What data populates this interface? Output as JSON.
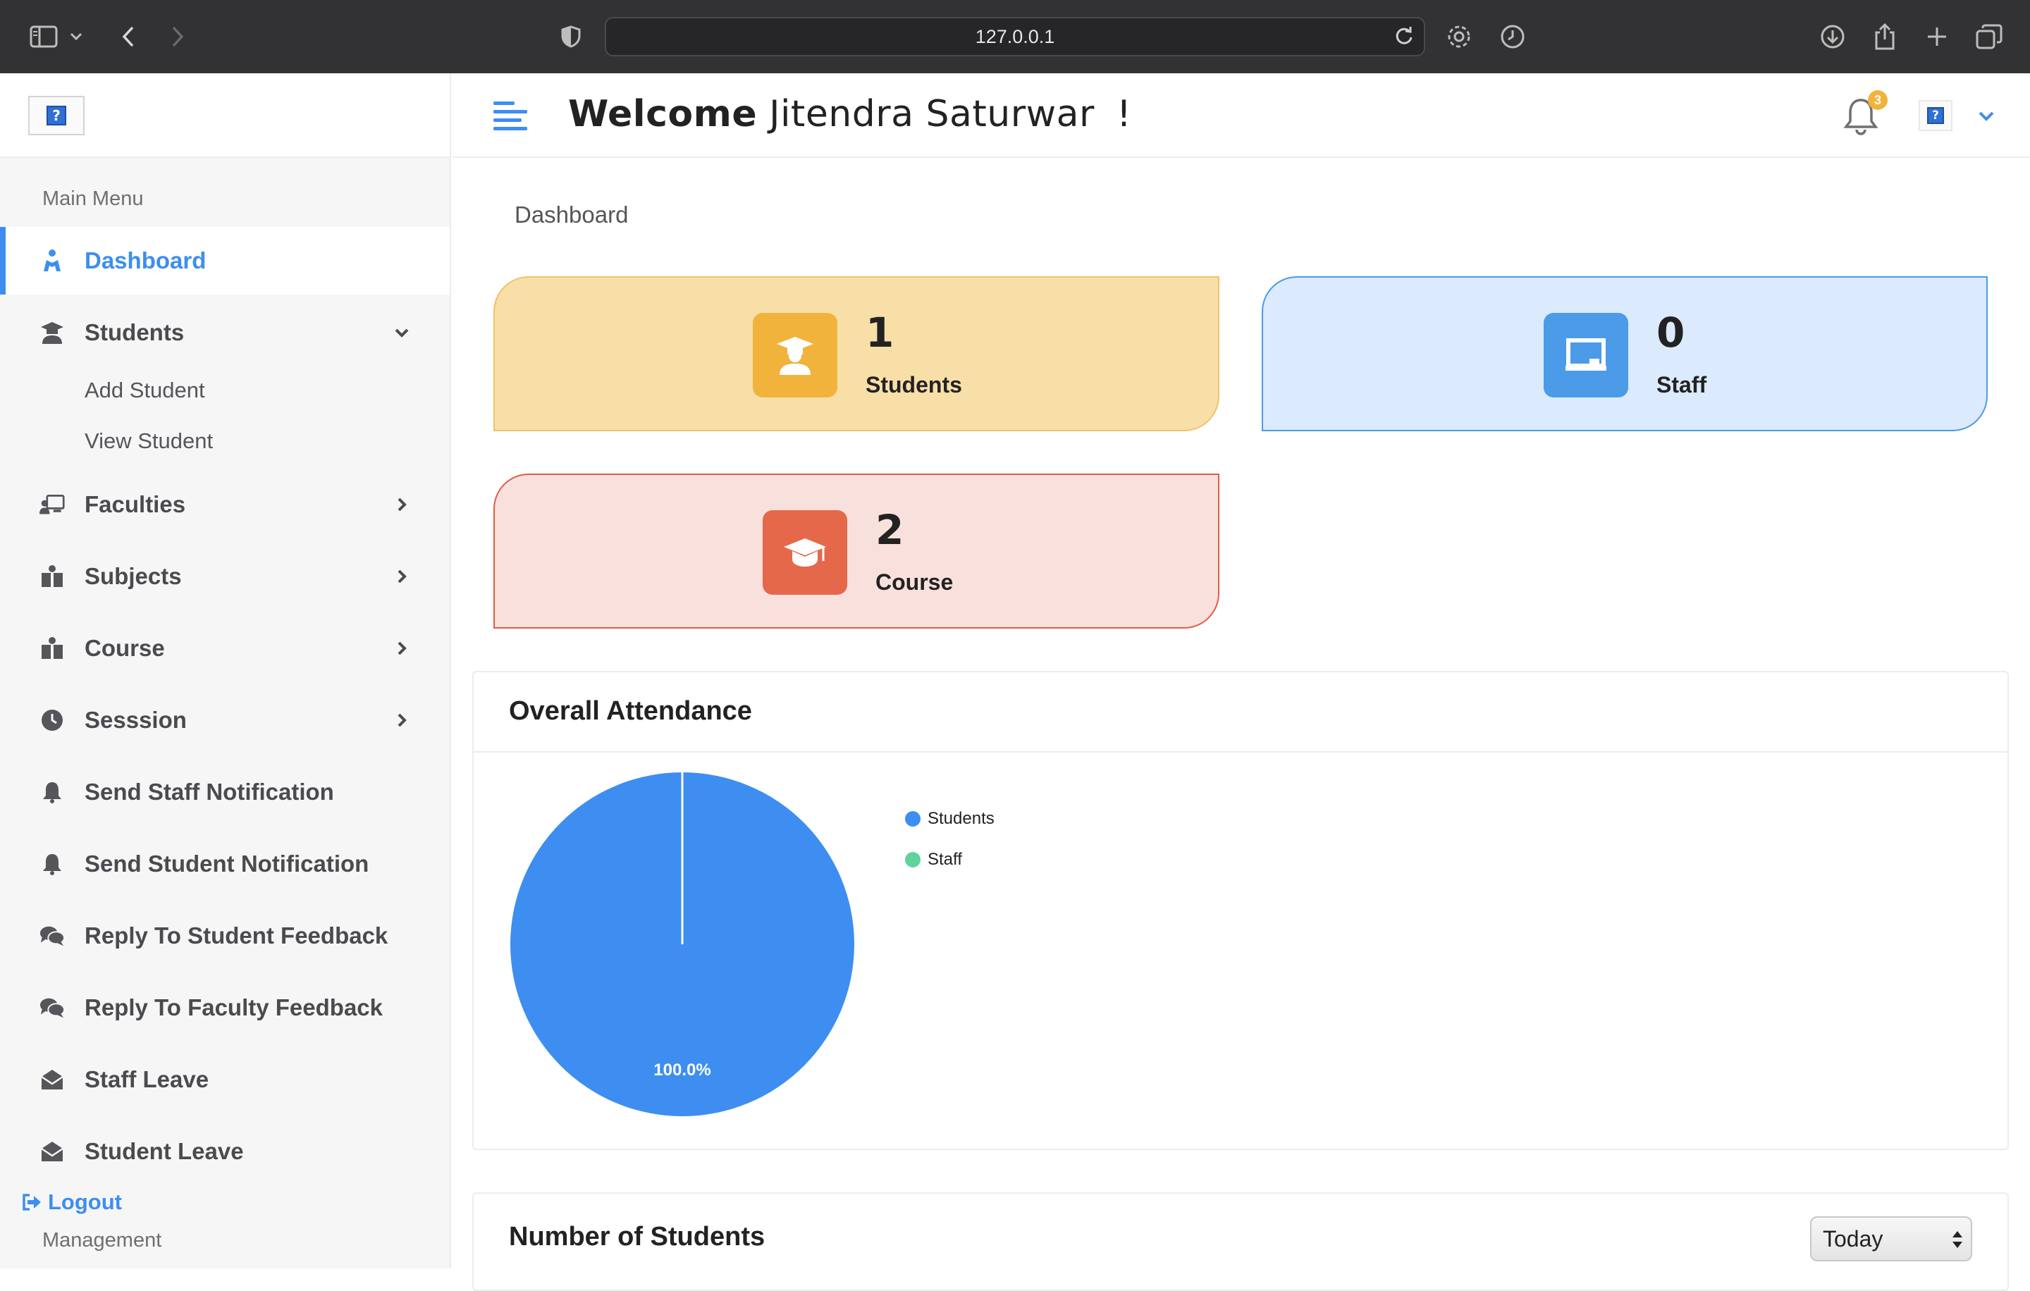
{
  "browser": {
    "url": "127.0.0.1"
  },
  "sidebar": {
    "menu_title": "Main Menu",
    "items": [
      {
        "label": "Dashboard",
        "icon": "dashboard-icon",
        "active": true
      },
      {
        "label": "Students",
        "icon": "student-icon",
        "expanded": true
      },
      {
        "label": "Faculties",
        "icon": "faculty-icon"
      },
      {
        "label": "Subjects",
        "icon": "book-icon"
      },
      {
        "label": "Course",
        "icon": "book-icon"
      },
      {
        "label": "Sesssion",
        "icon": "clock-icon"
      },
      {
        "label": "Send Staff Notification",
        "icon": "bell-icon"
      },
      {
        "label": "Send Student Notification",
        "icon": "bell-icon"
      },
      {
        "label": "Reply To Student Feedback",
        "icon": "comments-icon"
      },
      {
        "label": "Reply To Faculty Feedback",
        "icon": "comments-icon"
      },
      {
        "label": "Staff Leave",
        "icon": "envelope-open-icon"
      },
      {
        "label": "Student Leave",
        "icon": "envelope-open-icon"
      }
    ],
    "students_submenu": [
      "Add Student",
      "View Student"
    ],
    "logout_label": "Logout",
    "management_title": "Management"
  },
  "header": {
    "welcome_bold": "Welcome",
    "user_name": "Jitendra Saturwar",
    "exclaim": "!",
    "notification_count": "3"
  },
  "main": {
    "page_title": "Dashboard",
    "stats": [
      {
        "value": "1",
        "label": "Students",
        "color": "#f2b33d"
      },
      {
        "value": "0",
        "label": "Staff",
        "color": "#4b9be8"
      },
      {
        "value": "2",
        "label": "Course",
        "color": "#e5684a"
      }
    ],
    "attendance_title": "Overall Attendance",
    "students_panel_title": "Number of Students",
    "period_select": "Today"
  },
  "chart_data": {
    "type": "pie",
    "title": "Overall Attendance",
    "categories": [
      "Students",
      "Staff"
    ],
    "values": [
      100,
      0
    ],
    "colors": [
      "#3d8ef0",
      "#5fd39b"
    ],
    "data_labels": [
      "100.0%"
    ],
    "legend": "top-right"
  }
}
